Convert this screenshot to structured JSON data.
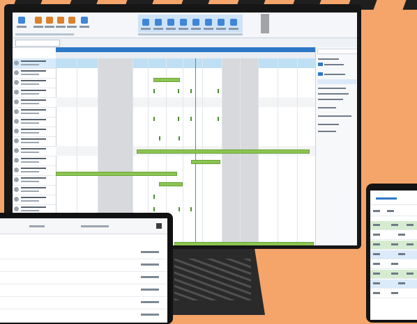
{
  "scene": {
    "description_tags": [
      "monitor-with-gantt-scheduler",
      "tablet",
      "phone"
    ]
  },
  "colors": {
    "background": "#f5a46a",
    "accent_blue": "#2d77c7",
    "bar_green": "#8cc451",
    "device_black": "#161616"
  },
  "icons": {
    "ribbon": [
      "filter-icon",
      "filter-icon",
      "filter-icon",
      "filter-icon",
      "calendar-icon",
      "view-icon",
      "save-icon"
    ],
    "menu": "hamburger-icon"
  }
}
